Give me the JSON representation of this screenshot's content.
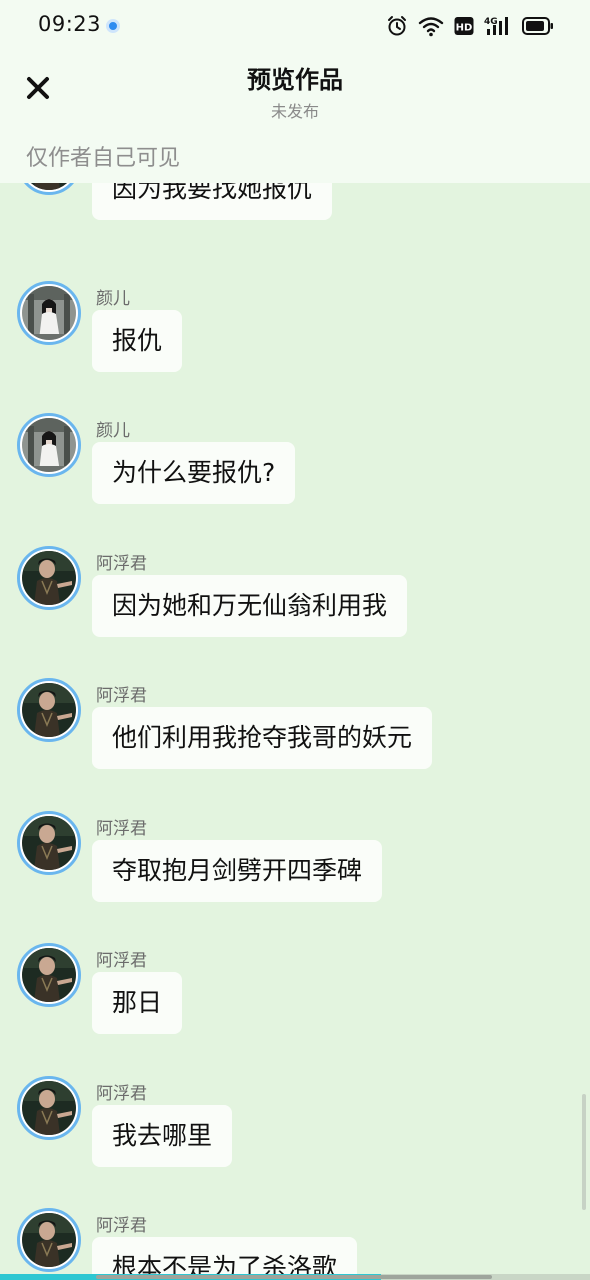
{
  "status_bar": {
    "time": "09:23",
    "network_label": "4G"
  },
  "header": {
    "title": "预览作品",
    "subtitle": "未发布",
    "notice": "仅作者自己可见"
  },
  "messages": [
    {
      "sender": "",
      "text": "因为我要找她报仇",
      "avatar": "man-avatar"
    },
    {
      "sender": "颜儿",
      "text": "报仇",
      "avatar": "woman-avatar"
    },
    {
      "sender": "颜儿",
      "text": "为什么要报仇?",
      "avatar": "woman-avatar"
    },
    {
      "sender": "阿浮君",
      "text": "因为她和万无仙翁利用我",
      "avatar": "man-avatar"
    },
    {
      "sender": "阿浮君",
      "text": "他们利用我抢夺我哥的妖元",
      "avatar": "man-avatar"
    },
    {
      "sender": "阿浮君",
      "text": "夺取抱月剑劈开四季碑",
      "avatar": "man-avatar"
    },
    {
      "sender": "阿浮君",
      "text": "那日",
      "avatar": "man-avatar"
    },
    {
      "sender": "阿浮君",
      "text": "我去哪里",
      "avatar": "man-avatar"
    },
    {
      "sender": "阿浮君",
      "text": "根本不是为了杀洛歌",
      "avatar": "man-avatar"
    }
  ],
  "progress": {
    "fraction": 0.645
  },
  "colors": {
    "background": "#e3f4df",
    "bubble": "#fafdf9",
    "avatar_ring": "#6ab6ee",
    "progress": "#2ec7d2"
  },
  "icons": [
    "close-icon",
    "alarm-icon",
    "wifi-icon",
    "hd-icon",
    "signal-icon",
    "battery-icon"
  ]
}
